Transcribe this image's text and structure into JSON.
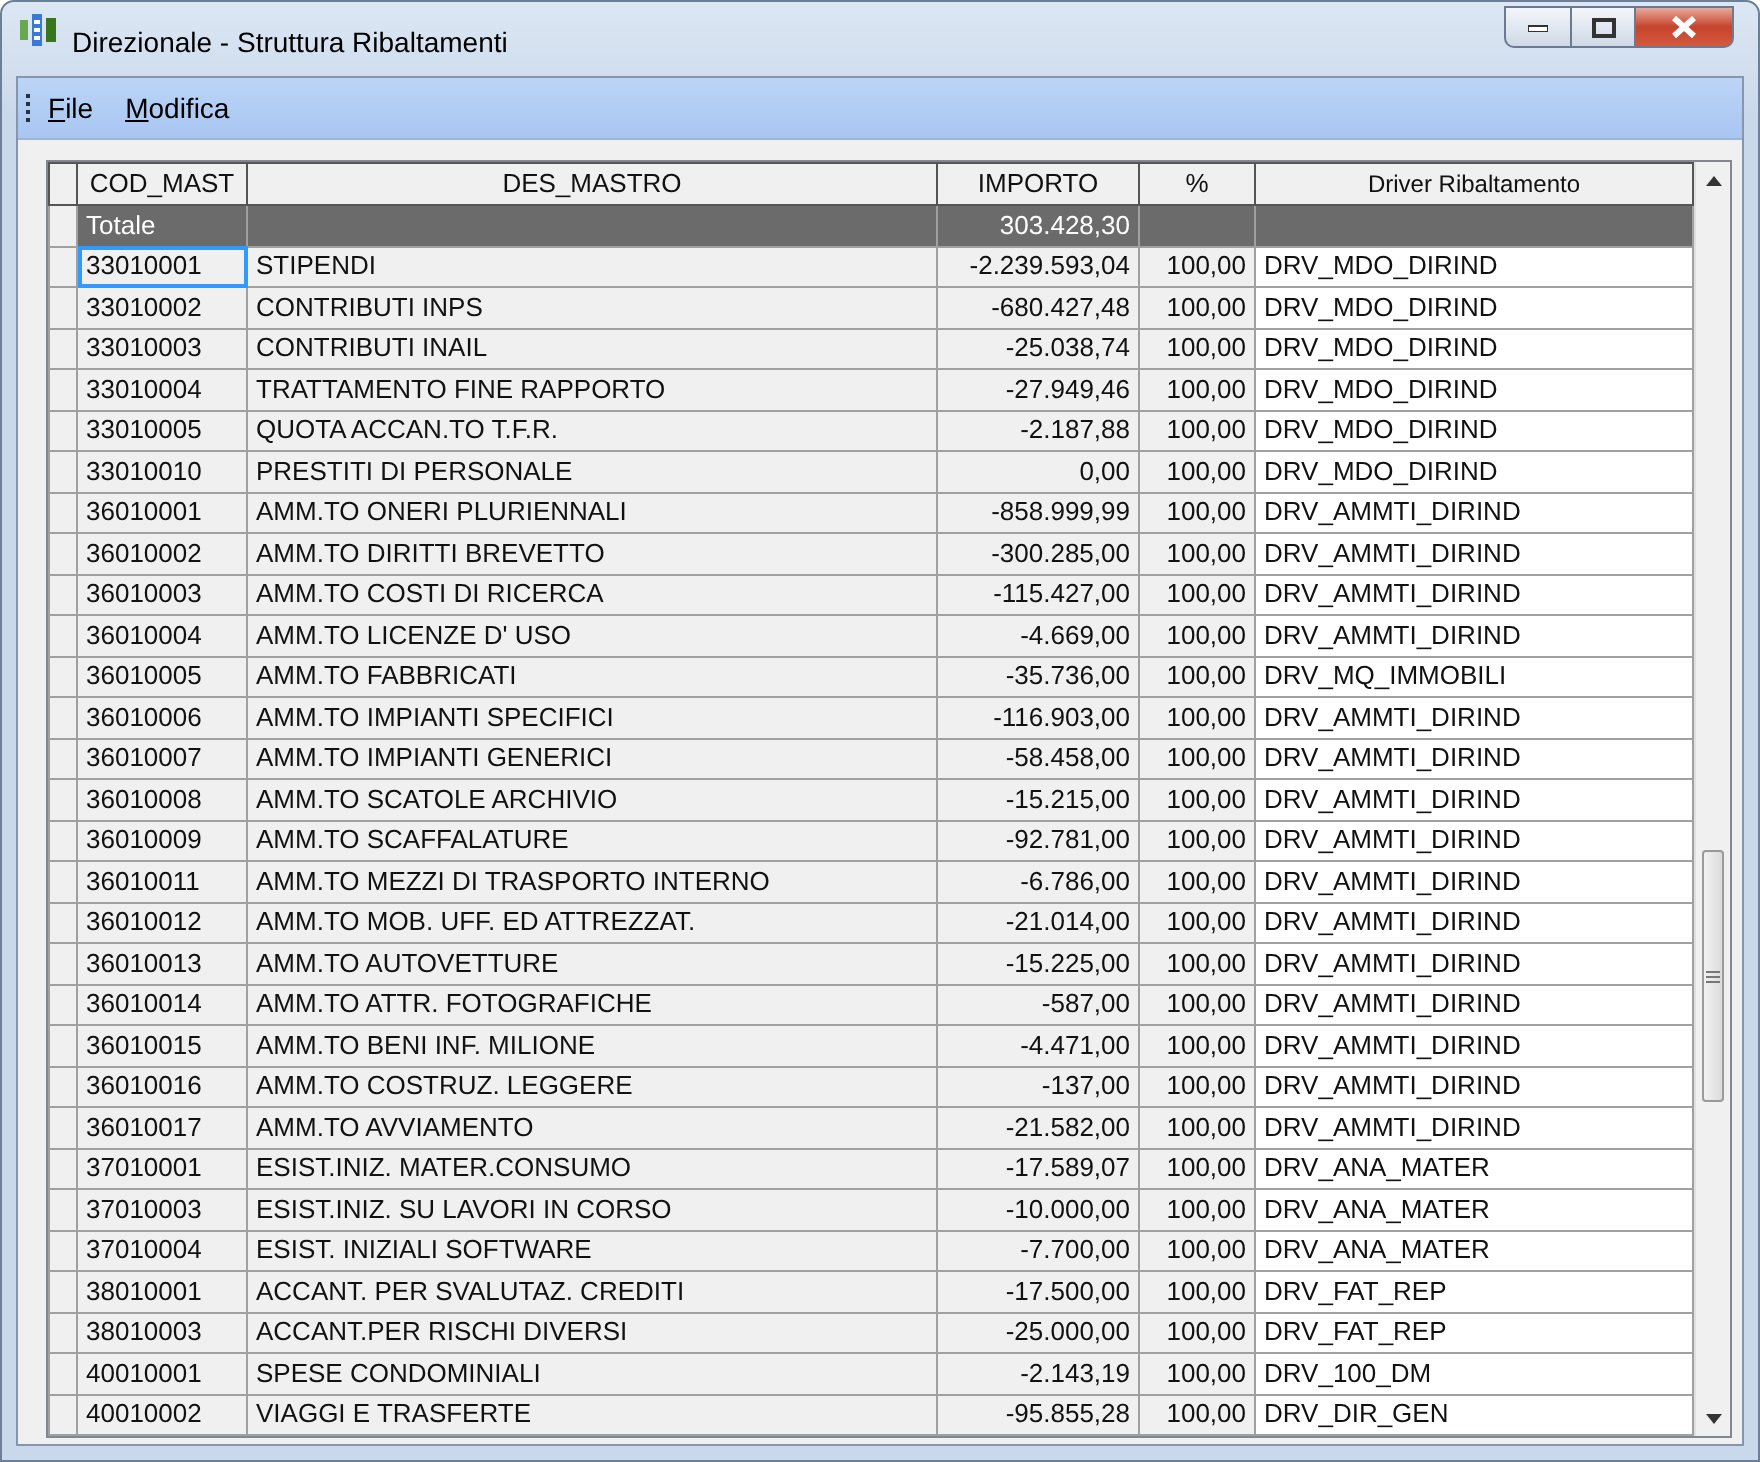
{
  "window": {
    "title": "Direzionale - Struttura Ribaltamenti"
  },
  "menu": [
    "File",
    "Modifica"
  ],
  "table": {
    "columns": [
      "COD_MAST",
      "DES_MASTRO",
      "IMPORTO",
      "%",
      "Driver Ribaltamento"
    ],
    "total": {
      "label": "Totale",
      "importo": "303.428,30"
    },
    "rows": [
      {
        "cod": "33010001",
        "des": "STIPENDI",
        "importo": "-2.239.593,04",
        "pct": "100,00",
        "driver": "DRV_MDO_DIRIND",
        "focused": true
      },
      {
        "cod": "33010002",
        "des": "CONTRIBUTI INPS",
        "importo": "-680.427,48",
        "pct": "100,00",
        "driver": "DRV_MDO_DIRIND",
        "focused": false
      },
      {
        "cod": "33010003",
        "des": "CONTRIBUTI INAIL",
        "importo": "-25.038,74",
        "pct": "100,00",
        "driver": "DRV_MDO_DIRIND",
        "focused": false
      },
      {
        "cod": "33010004",
        "des": "TRATTAMENTO FINE RAPPORTO",
        "importo": "-27.949,46",
        "pct": "100,00",
        "driver": "DRV_MDO_DIRIND",
        "focused": false
      },
      {
        "cod": "33010005",
        "des": "QUOTA ACCAN.TO T.F.R.",
        "importo": "-2.187,88",
        "pct": "100,00",
        "driver": "DRV_MDO_DIRIND",
        "focused": false
      },
      {
        "cod": "33010010",
        "des": "PRESTITI DI PERSONALE",
        "importo": "0,00",
        "pct": "100,00",
        "driver": "DRV_MDO_DIRIND",
        "focused": false
      },
      {
        "cod": "36010001",
        "des": "AMM.TO ONERI PLURIENNALI",
        "importo": "-858.999,99",
        "pct": "100,00",
        "driver": "DRV_AMMTI_DIRIND",
        "focused": false
      },
      {
        "cod": "36010002",
        "des": "AMM.TO DIRITTI BREVETTO",
        "importo": "-300.285,00",
        "pct": "100,00",
        "driver": "DRV_AMMTI_DIRIND",
        "focused": false
      },
      {
        "cod": "36010003",
        "des": "AMM.TO COSTI DI RICERCA",
        "importo": "-115.427,00",
        "pct": "100,00",
        "driver": "DRV_AMMTI_DIRIND",
        "focused": false
      },
      {
        "cod": "36010004",
        "des": "AMM.TO LICENZE D' USO",
        "importo": "-4.669,00",
        "pct": "100,00",
        "driver": "DRV_AMMTI_DIRIND",
        "focused": false
      },
      {
        "cod": "36010005",
        "des": "AMM.TO FABBRICATI",
        "importo": "-35.736,00",
        "pct": "100,00",
        "driver": "DRV_MQ_IMMOBILI",
        "focused": false
      },
      {
        "cod": "36010006",
        "des": "AMM.TO IMPIANTI SPECIFICI",
        "importo": "-116.903,00",
        "pct": "100,00",
        "driver": "DRV_AMMTI_DIRIND",
        "focused": false
      },
      {
        "cod": "36010007",
        "des": "AMM.TO IMPIANTI GENERICI",
        "importo": "-58.458,00",
        "pct": "100,00",
        "driver": "DRV_AMMTI_DIRIND",
        "focused": false
      },
      {
        "cod": "36010008",
        "des": "AMM.TO SCATOLE ARCHIVIO",
        "importo": "-15.215,00",
        "pct": "100,00",
        "driver": "DRV_AMMTI_DIRIND",
        "focused": false
      },
      {
        "cod": "36010009",
        "des": "AMM.TO SCAFFALATURE",
        "importo": "-92.781,00",
        "pct": "100,00",
        "driver": "DRV_AMMTI_DIRIND",
        "focused": false
      },
      {
        "cod": "36010011",
        "des": "AMM.TO MEZZI DI TRASPORTO INTERNO",
        "importo": "-6.786,00",
        "pct": "100,00",
        "driver": "DRV_AMMTI_DIRIND",
        "focused": false
      },
      {
        "cod": "36010012",
        "des": "AMM.TO MOB. UFF. ED ATTREZZAT.",
        "importo": "-21.014,00",
        "pct": "100,00",
        "driver": "DRV_AMMTI_DIRIND",
        "focused": false
      },
      {
        "cod": "36010013",
        "des": "AMM.TO AUTOVETTURE",
        "importo": "-15.225,00",
        "pct": "100,00",
        "driver": "DRV_AMMTI_DIRIND",
        "focused": false
      },
      {
        "cod": "36010014",
        "des": "AMM.TO ATTR. FOTOGRAFICHE",
        "importo": "-587,00",
        "pct": "100,00",
        "driver": "DRV_AMMTI_DIRIND",
        "focused": false
      },
      {
        "cod": "36010015",
        "des": "AMM.TO BENI INF. MILIONE",
        "importo": "-4.471,00",
        "pct": "100,00",
        "driver": "DRV_AMMTI_DIRIND",
        "focused": false
      },
      {
        "cod": "36010016",
        "des": "AMM.TO COSTRUZ. LEGGERE",
        "importo": "-137,00",
        "pct": "100,00",
        "driver": "DRV_AMMTI_DIRIND",
        "focused": false
      },
      {
        "cod": "36010017",
        "des": "AMM.TO AVVIAMENTO",
        "importo": "-21.582,00",
        "pct": "100,00",
        "driver": "DRV_AMMTI_DIRIND",
        "focused": false
      },
      {
        "cod": "37010001",
        "des": "ESIST.INIZ. MATER.CONSUMO",
        "importo": "-17.589,07",
        "pct": "100,00",
        "driver": "DRV_ANA_MATER",
        "focused": false
      },
      {
        "cod": "37010003",
        "des": "ESIST.INIZ. SU LAVORI IN CORSO",
        "importo": "-10.000,00",
        "pct": "100,00",
        "driver": "DRV_ANA_MATER",
        "focused": false
      },
      {
        "cod": "37010004",
        "des": "ESIST. INIZIALI SOFTWARE",
        "importo": "-7.700,00",
        "pct": "100,00",
        "driver": "DRV_ANA_MATER",
        "focused": false
      },
      {
        "cod": "38010001",
        "des": "ACCANT. PER SVALUTAZ. CREDITI",
        "importo": "-17.500,00",
        "pct": "100,00",
        "driver": "DRV_FAT_REP",
        "focused": false
      },
      {
        "cod": "38010003",
        "des": "ACCANT.PER RISCHI DIVERSI",
        "importo": "-25.000,00",
        "pct": "100,00",
        "driver": "DRV_FAT_REP",
        "focused": false
      },
      {
        "cod": "40010001",
        "des": "SPESE CONDOMINIALI",
        "importo": "-2.143,19",
        "pct": "100,00",
        "driver": "DRV_100_DM",
        "focused": false
      },
      {
        "cod": "40010002",
        "des": "VIAGGI E TRASFERTE",
        "importo": "-95.855,28",
        "pct": "100,00",
        "driver": "DRV_DIR_GEN",
        "focused": false
      }
    ]
  }
}
